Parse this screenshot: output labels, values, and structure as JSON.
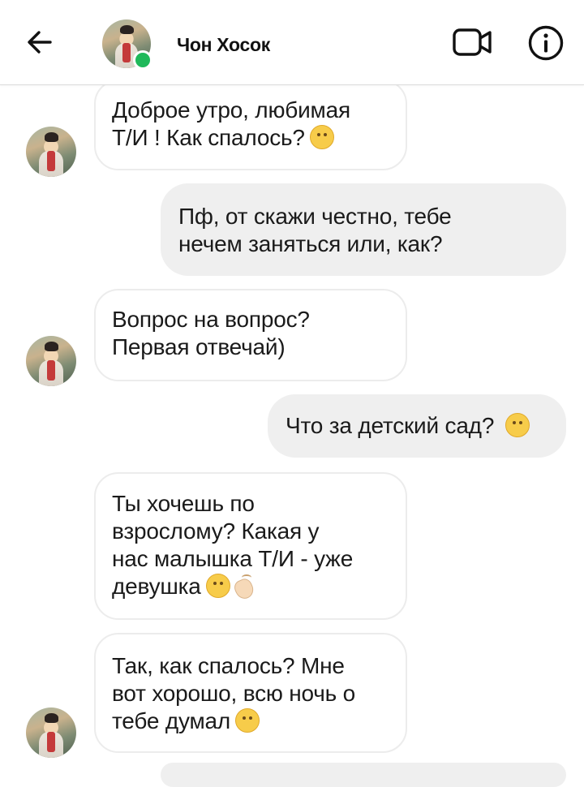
{
  "header": {
    "contact_name": "Чон Хосок",
    "online_color": "#1fb95a",
    "icons": [
      "back-arrow-icon",
      "video-call-icon",
      "info-icon"
    ]
  },
  "messages": [
    {
      "direction": "incoming",
      "lines": [
        "Доброе утро,  любимая",
        "Т/И ! Как спалось?"
      ],
      "emoji": "thinking-face"
    },
    {
      "direction": "outgoing",
      "lines": [
        "Пф,  от скажи честно,  тебе",
        "нечем заняться или,  как?"
      ]
    },
    {
      "direction": "incoming",
      "lines": [
        "Вопрос на вопрос?",
        "Первая отвечай)"
      ]
    },
    {
      "direction": "outgoing",
      "lines": [
        "Что за детский сад?"
      ],
      "emoji": "unamused-face"
    },
    {
      "direction": "incoming",
      "lines": [
        "Ты хочешь по",
        "взрослому? Какая у",
        "нас малышка Т/И - уже",
        "девушка"
      ],
      "emoji": "smirking-face clapping-hands"
    },
    {
      "direction": "incoming",
      "lines": [
        "Так,  как спалось?  Мне",
        "вот хорошо,  всю ночь о",
        "тебе думал"
      ],
      "emoji": "smiling-face"
    }
  ],
  "colors": {
    "incoming_bubble_border": "#ececec",
    "outgoing_bubble_bg": "#efefef",
    "text": "#1a1a1a"
  }
}
